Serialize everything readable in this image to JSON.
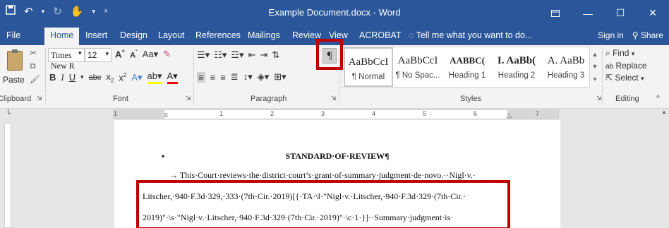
{
  "titlebar": {
    "title": "Example Document.docx - Word",
    "qat_icons": [
      "save-icon",
      "undo-icon",
      "redo-icon",
      "touch-mode-icon",
      "customize-icon"
    ],
    "window_controls": [
      "ribbon-display-icon",
      "minimize-icon",
      "maximize-icon",
      "close-icon"
    ]
  },
  "tabs": {
    "file": "File",
    "home": "Home",
    "insert": "Insert",
    "design": "Design",
    "layout": "Layout",
    "references": "References",
    "mailings": "Mailings",
    "review": "Review",
    "view": "View",
    "acrobat": "ACROBAT",
    "tell_me": "Tell me what you want to do...",
    "sign_in": "Sign in",
    "share": "Share"
  },
  "ribbon": {
    "clipboard": {
      "paste": "Paste",
      "label": "Clipboard"
    },
    "font": {
      "font_name": "Times New R",
      "font_size": "12",
      "label": "Font"
    },
    "paragraph": {
      "label": "Paragraph",
      "show_marks": "¶"
    },
    "styles": {
      "label": "Styles",
      "items": [
        {
          "preview": "AaBbCcI",
          "name": "¶ Normal"
        },
        {
          "preview": "AaBbCcI",
          "name": "¶ No Spac..."
        },
        {
          "preview": "AABBC(",
          "name": "Heading 1"
        },
        {
          "preview": "I. AaBb(",
          "name": "Heading 2"
        },
        {
          "preview": "A. AaBb",
          "name": "Heading 3"
        }
      ]
    },
    "editing": {
      "label": "Editing",
      "find": "Find",
      "replace": "Replace",
      "select": "Select"
    }
  },
  "ruler": {
    "numbers": [
      "1",
      "1",
      "2",
      "3",
      "4",
      "5",
      "6",
      "7"
    ]
  },
  "document": {
    "heading": "STANDARD·OF·REVIEW¶",
    "line1": "→  This·Court·reviews·the·district·court’s·grant·of·summary·judgment·de·novo.··Nigl·v.·",
    "line2": "Litscher,·940·F.3d·329,·333·(7th·Cir.·2019)[{·TA·\\l·\"Nigl·v.·Litscher,·940·F.3d·329·(7th·Cir.·",
    "line3": "2019)\"·\\s·\"Nigl·v.·Litscher,·940·F.3d·329·(7th·Cir.·2019)\"·\\c·1·}]··Summary·judgment·is·"
  }
}
